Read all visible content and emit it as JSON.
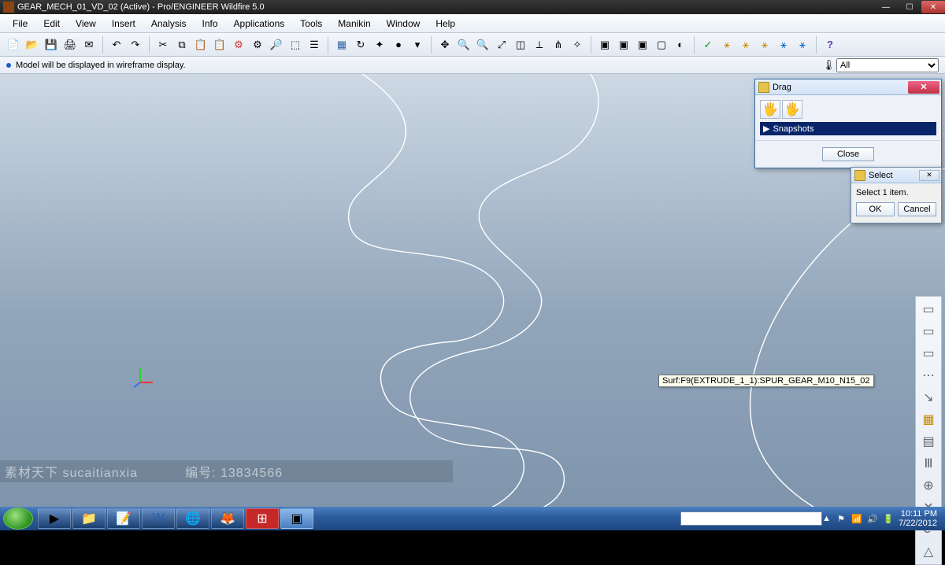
{
  "title": "GEAR_MECH_01_VD_02 (Active) - Pro/ENGINEER Wildfire 5.0",
  "menus": [
    "File",
    "Edit",
    "View",
    "Insert",
    "Analysis",
    "Info",
    "Applications",
    "Tools",
    "Manikin",
    "Window",
    "Help"
  ],
  "status_msg": "Model will be displayed in wireframe display.",
  "filter_label": "All",
  "tooltip": "Surf:F9(EXTRUDE_1_1):SPUR_GEAR_M10_N15_02",
  "drag_dialog": {
    "title": "Drag",
    "snapshots_label": "Snapshots",
    "close_label": "Close"
  },
  "select_dialog": {
    "title": "Select",
    "prompt": "Select 1 item.",
    "ok": "OK",
    "cancel": "Cancel"
  },
  "watermark": {
    "left": "素材天下 sucaitianxia",
    "right": "编号: 13834566"
  },
  "taskbar": {
    "clock_time": "10:11 PM",
    "clock_date": "7/22/2012"
  }
}
